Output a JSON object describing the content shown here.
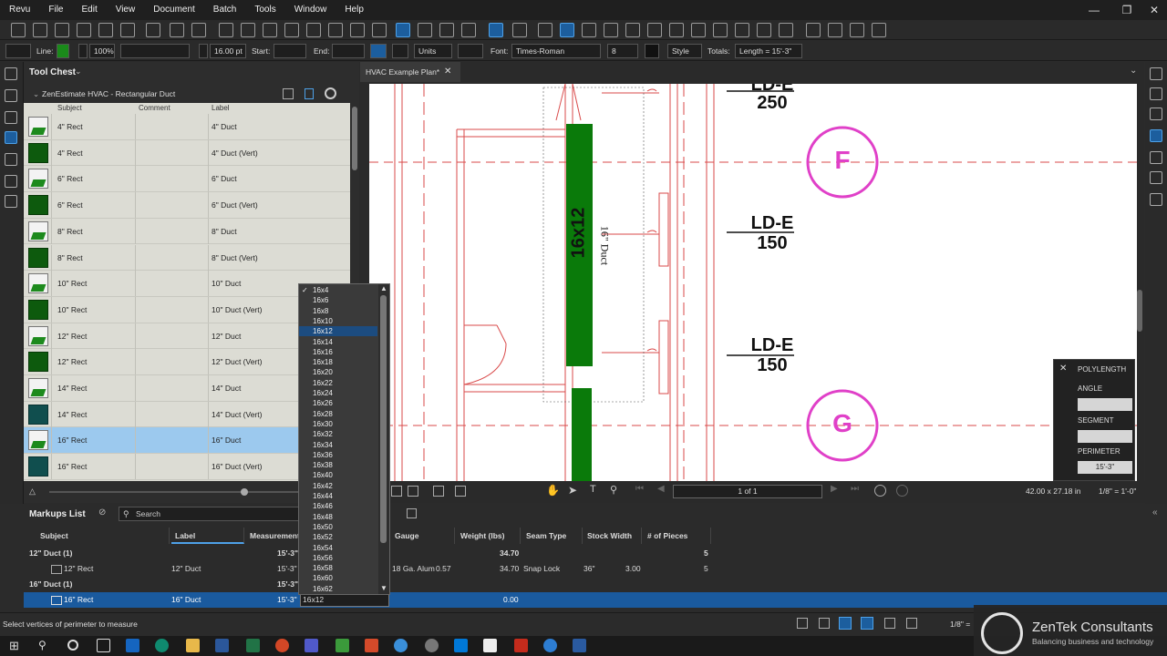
{
  "menubar": {
    "items": [
      "Revu",
      "File",
      "Edit",
      "View",
      "Document",
      "Batch",
      "Tools",
      "Window",
      "Help"
    ]
  },
  "toolbar2": {
    "line_label": "Line:",
    "zoom": "100%",
    "line_width": "16.00 pt",
    "start_label": "Start:",
    "end_label": "End:",
    "units": "Units",
    "font_label": "Font:",
    "font": "Times-Roman",
    "font_size": "8",
    "style": "Style",
    "totals_label": "Totals:",
    "totals_value": "Length = 15'-3\""
  },
  "tool_chest": {
    "title": "Tool Chest",
    "set_name": "ZenEstimate HVAC - Rectangular Duct",
    "columns": [
      "Subject",
      "Comment",
      "Label"
    ],
    "rows": [
      {
        "subject": "4\" Rect",
        "label": "4\" Duct",
        "icon": "outline"
      },
      {
        "subject": "4\" Rect",
        "label": "4\" Duct (Vert)",
        "icon": "solid"
      },
      {
        "subject": "6\" Rect",
        "label": "6\" Duct",
        "icon": "outline"
      },
      {
        "subject": "6\" Rect",
        "label": "6\" Duct (Vert)",
        "icon": "solid"
      },
      {
        "subject": "8\" Rect",
        "label": "8\" Duct",
        "icon": "outline"
      },
      {
        "subject": "8\" Rect",
        "label": "8\" Duct (Vert)",
        "icon": "solid"
      },
      {
        "subject": "10\" Rect",
        "label": "10\" Duct",
        "icon": "outline"
      },
      {
        "subject": "10\" Rect",
        "label": "10\" Duct (Vert)",
        "icon": "solid"
      },
      {
        "subject": "12\" Rect",
        "label": "12\" Duct",
        "icon": "outline"
      },
      {
        "subject": "12\" Rect",
        "label": "12\" Duct (Vert)",
        "icon": "solid"
      },
      {
        "subject": "14\" Rect",
        "label": "14\" Duct",
        "icon": "outline"
      },
      {
        "subject": "14\" Rect",
        "label": "14\" Duct (Vert)",
        "icon": "teal"
      },
      {
        "subject": "16\" Rect",
        "label": "16\" Duct",
        "icon": "outline",
        "selected": true
      },
      {
        "subject": "16\" Rect",
        "label": "16\" Duct (Vert)",
        "icon": "teal"
      }
    ]
  },
  "document": {
    "tab_title": "HVAC Example Plan*",
    "tags": [
      {
        "code": "LD-E",
        "value": "250"
      },
      {
        "code": "LD-E",
        "value": "150"
      },
      {
        "code": "LD-E",
        "value": "150"
      }
    ],
    "grid_bubbles": [
      "F",
      "G"
    ],
    "duct_size_text": "16x12",
    "duct_label_text": "16\" Duct",
    "colors": {
      "duct": "#0a7a0a",
      "plan_lines": "#d94a4a",
      "bubble": "#e040c8"
    }
  },
  "navbar": {
    "page": "1 of 1",
    "dimensions": "42.00 x 27.18 in",
    "scale": "1/8\" = 1'-0\""
  },
  "polylength": {
    "title": "POLYLENGTH",
    "angle_label": "ANGLE",
    "segment_label": "SEGMENT",
    "perimeter_label": "PERIMETER",
    "perimeter_value": "15'-3\""
  },
  "markups": {
    "title": "Markups List",
    "search_placeholder": "Search",
    "columns": [
      "Subject",
      "Label",
      "Measurement",
      "Gauge",
      "Weight (lbs)",
      "Seam Type",
      "Stock Width",
      "# of Pieces"
    ],
    "group1": {
      "title": "12\" Duct (1)",
      "measurement": "15'-3\"",
      "weight": "34.70",
      "pieces": "5"
    },
    "row1": {
      "subject": "12\" Rect",
      "label": "12\" Duct",
      "measurement": "15'-3\"",
      "gauge": "18 Ga. Alum",
      "gauge_val": "0.57",
      "weight": "34.70",
      "seam": "Snap Lock",
      "stock": "36\"",
      "stock_val": "3.00",
      "pieces": "5"
    },
    "group2": {
      "title": "16\" Duct (1)",
      "measurement": "15'-3\""
    },
    "row2": {
      "subject": "16\" Rect",
      "label": "16\" Duct",
      "measurement": "15'-3\"",
      "size": "16x12",
      "weight": "0.00"
    }
  },
  "dropdown": {
    "options": [
      "16x4",
      "16x6",
      "16x8",
      "16x10",
      "16x12",
      "16x14",
      "16x16",
      "16x18",
      "16x20",
      "16x22",
      "16x24",
      "16x26",
      "16x28",
      "16x30",
      "16x32",
      "16x34",
      "16x36",
      "16x38",
      "16x40",
      "16x42",
      "16x44",
      "16x46",
      "16x48",
      "16x50",
      "16x52",
      "16x54",
      "16x56",
      "16x58",
      "16x60",
      "16x62"
    ],
    "checked": "16x4",
    "hovered": "16x12"
  },
  "status": {
    "message": "Select vertices of perimeter to measure",
    "scale": "1/8\" ="
  },
  "logo": {
    "company": "ZenTek Consultants",
    "tagline": "Balancing business and technology"
  }
}
